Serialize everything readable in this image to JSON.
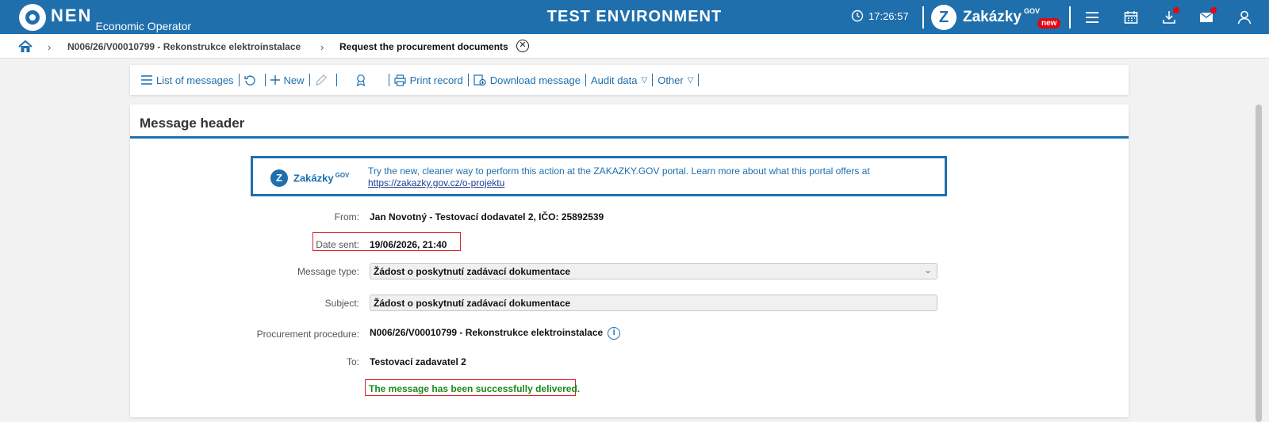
{
  "topbar": {
    "logo_text": "NEN",
    "logo_subtitle": "Economic Operator",
    "environment": "TEST ENVIRONMENT",
    "time": "17:26:57",
    "portal_name": "Zakázky",
    "portal_sup": "GOV",
    "portal_badge": "new"
  },
  "breadcrumb": {
    "items": [
      "N006/26/V00010799 - Rekonstrukce elektroinstalace",
      "Request the procurement documents"
    ]
  },
  "toolbar": {
    "list_of_messages": "List of messages",
    "new": "New",
    "print_record": "Print record",
    "download_message": "Download message",
    "audit_data": "Audit data",
    "other": "Other"
  },
  "card": {
    "title": "Message header",
    "promo": {
      "logo_name": "Zakázky",
      "logo_sup": "GOV",
      "text": "Try the new, cleaner way to perform this action at the ZAKAZKY.GOV portal. Learn more about what this portal offers at",
      "link": "https://zakazky.gov.cz/o-projektu"
    },
    "fields": {
      "from_label": "From:",
      "from_value": "Jan Novotný - Testovací dodavatel 2, IČO: 25892539",
      "date_label": "Date sent:",
      "date_value": "19/06/2026, 21:40",
      "type_label": "Message type:",
      "type_value": "Žádost o poskytnutí zadávací dokumentace",
      "subject_label": "Subject:",
      "subject_value": "Žádost o poskytnutí zadávací dokumentace",
      "procedure_label": "Procurement procedure:",
      "procedure_value": "N006/26/V00010799 - Rekonstrukce elektroinstalace",
      "to_label": "To:",
      "to_value": "Testovací zadavatel 2"
    },
    "status": "The message has been successfully delivered."
  },
  "colors": {
    "brand": "#1f6fad",
    "alert": "#d9252c",
    "success": "#1a8a1a"
  }
}
